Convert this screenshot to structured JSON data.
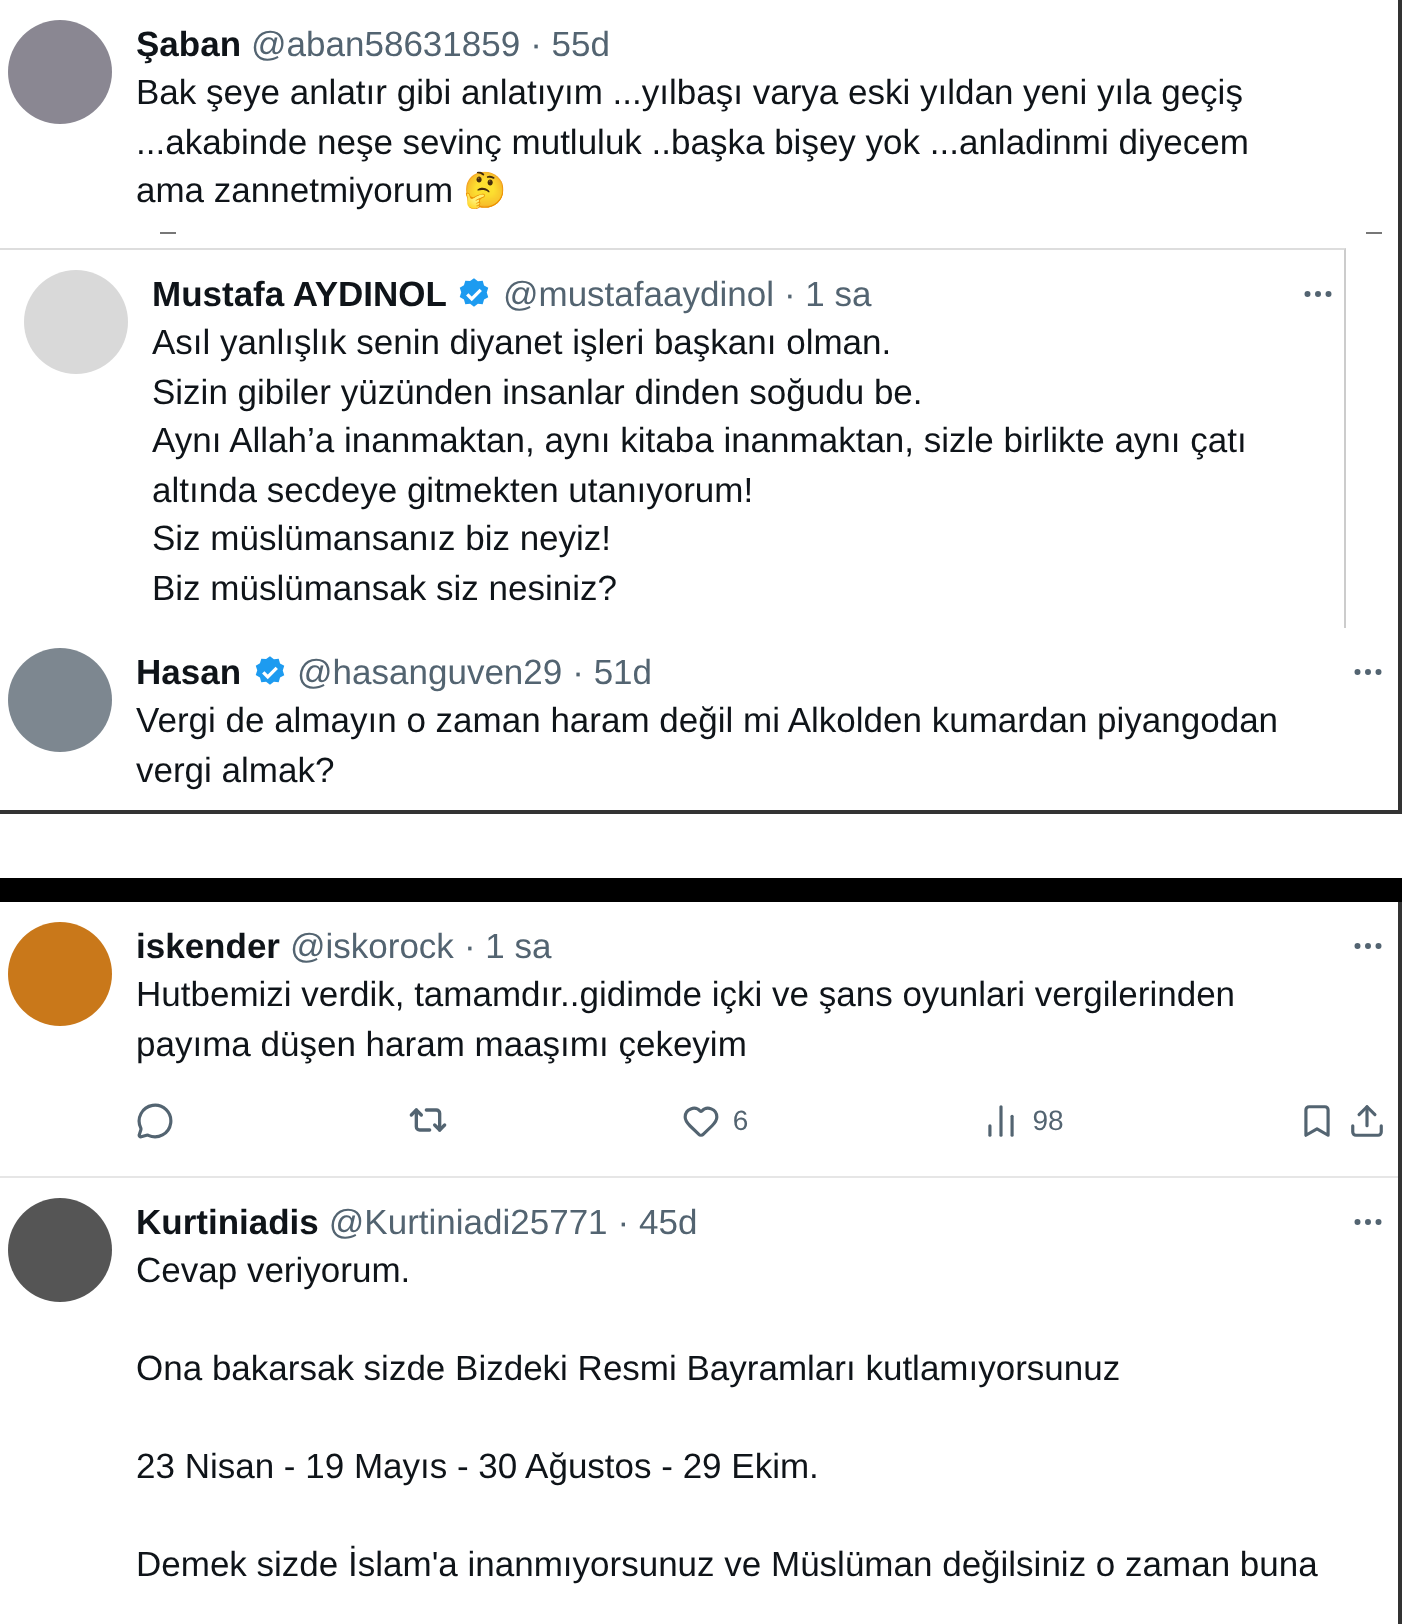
{
  "top_panel": {
    "tweets": [
      {
        "name": "Şaban",
        "handle": "@aban58631859",
        "time": "· 55d",
        "verified": false,
        "more_menu": false,
        "paragraphs": [
          [
            "Bak şeye anlatır gibi anlatıyım ...yılbaşı varya eski yıldan yeni yıla geçiş",
            "...akabinde neşe sevinç mutluluk ..başka bişey yok ...anladinmi diyecem",
            "ama zannetmiyorum 🤔"
          ]
        ]
      },
      {
        "name": "Mustafa AYDINOL",
        "handle": "@mustafaaydinol",
        "time": "· 1 sa",
        "verified": true,
        "more_menu": true,
        "paragraphs": [
          [
            "Asıl yanlışlık senin diyanet işleri başkanı olman.",
            "Sizin gibiler yüzünden insanlar dinden soğudu be.",
            "Aynı Allah’a inanmaktan, aynı kitaba inanmaktan, sizle birlikte aynı çatı",
            "altında secdeye gitmekten utanıyorum!",
            "Siz müslümansanız biz neyiz!",
            "Biz müslümansak siz nesiniz?"
          ]
        ]
      },
      {
        "name": "Hasan",
        "handle": "@hasanguven29",
        "time": "· 51d",
        "verified": true,
        "more_menu": true,
        "paragraphs": [
          [
            "Vergi de almayın o zaman haram değil mi Alkolden kumardan piyangodan",
            "vergi almak?"
          ]
        ]
      }
    ]
  },
  "bottom_panel": {
    "tweets": [
      {
        "name": "iskender",
        "handle": "@iskorock",
        "time": "· 1 sa",
        "verified": false,
        "more_menu": true,
        "paragraphs": [
          [
            "Hutbemizi verdik, tamamdır..gidimde içki ve şans oyunlari vergilerinden",
            "payıma düşen haram maaşımı çekeyim"
          ]
        ],
        "actions": {
          "likes": "6",
          "views": "98"
        }
      },
      {
        "name": "Kurtiniadis",
        "handle": "@Kurtiniadi25771",
        "time": "· 45d",
        "verified": false,
        "more_menu": true,
        "paragraphs": [
          [
            "Cevap veriyorum."
          ],
          [
            "Ona bakarsak sizde Bizdeki Resmi Bayramları kutlamıyorsunuz"
          ],
          [
            "23 Nisan - 19 Mayıs - 30 Ağustos - 29 Ekim."
          ],
          [
            "Demek sizde İslam'a inanmıyorsunuz ve Müslüman değilsiniz o zaman buna"
          ]
        ]
      }
    ]
  }
}
